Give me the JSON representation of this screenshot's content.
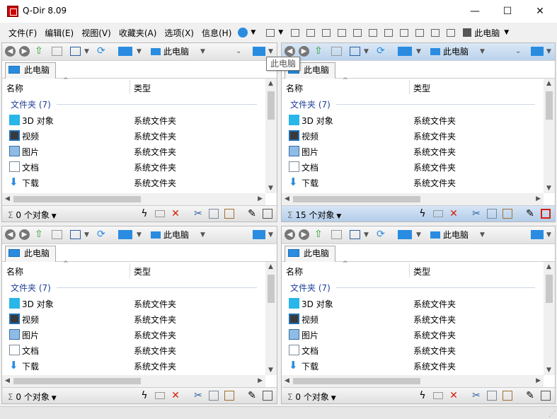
{
  "window": {
    "title": "Q-Dir 8.09",
    "minimize": "—",
    "maximize": "☐",
    "close": "✕"
  },
  "menu": {
    "items": [
      "文件(F)",
      "编辑(E)",
      "视图(V)",
      "收藏夹(A)",
      "选项(X)",
      "信息(H)"
    ],
    "this_pc": "此电脑"
  },
  "tooltip": "此电脑",
  "panes": [
    {
      "address": "此电脑",
      "tab": "此电脑",
      "col_name": "名称",
      "col_type": "类型",
      "group": "文件夹 (7)",
      "rows": [
        {
          "name": "3D 对象",
          "type": "系统文件夹"
        },
        {
          "name": "视频",
          "type": "系统文件夹"
        },
        {
          "name": "图片",
          "type": "系统文件夹"
        },
        {
          "name": "文档",
          "type": "系统文件夹"
        },
        {
          "name": "下载",
          "type": "系统文件夹"
        }
      ],
      "status": "0 个对象",
      "active": false
    },
    {
      "address": "此电脑",
      "tab": "此电脑",
      "col_name": "名称",
      "col_type": "类型",
      "group": "文件夹 (7)",
      "rows": [
        {
          "name": "3D 对象",
          "type": "系统文件夹"
        },
        {
          "name": "视频",
          "type": "系统文件夹"
        },
        {
          "name": "图片",
          "type": "系统文件夹"
        },
        {
          "name": "文档",
          "type": "系统文件夹"
        },
        {
          "name": "下载",
          "type": "系统文件夹"
        }
      ],
      "status": "15 个对象",
      "active": true
    },
    {
      "address": "此电脑",
      "tab": "此电脑",
      "col_name": "名称",
      "col_type": "类型",
      "group": "文件夹 (7)",
      "rows": [
        {
          "name": "3D 对象",
          "type": "系统文件夹"
        },
        {
          "name": "视频",
          "type": "系统文件夹"
        },
        {
          "name": "图片",
          "type": "系统文件夹"
        },
        {
          "name": "文档",
          "type": "系统文件夹"
        },
        {
          "name": "下载",
          "type": "系统文件夹"
        }
      ],
      "status": "0 个对象",
      "active": false
    },
    {
      "address": "此电脑",
      "tab": "此电脑",
      "col_name": "名称",
      "col_type": "类型",
      "group": "文件夹 (7)",
      "rows": [
        {
          "name": "3D 对象",
          "type": "系统文件夹"
        },
        {
          "name": "视频",
          "type": "系统文件夹"
        },
        {
          "name": "图片",
          "type": "系统文件夹"
        },
        {
          "name": "文档",
          "type": "系统文件夹"
        },
        {
          "name": "下载",
          "type": "系统文件夹"
        }
      ],
      "status": "0 个对象",
      "active": false
    }
  ],
  "row_icons": [
    "cube-3d-icon",
    "video-folder-icon",
    "pictures-folder-icon",
    "documents-folder-icon",
    "downloads-arrow-icon"
  ],
  "colors": {
    "accent": "#2a8ce0",
    "group_text": "#1e3f9a",
    "active_pane": "#b9d2ec",
    "delete_red": "#d81e06"
  }
}
